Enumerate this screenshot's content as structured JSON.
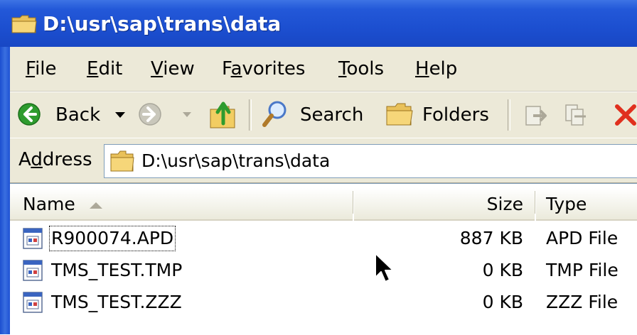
{
  "window": {
    "title": "D:\\usr\\sap\\trans\\data"
  },
  "menu": {
    "items": [
      {
        "accel": "F",
        "rest": "ile"
      },
      {
        "accel": "E",
        "rest": "dit"
      },
      {
        "accel": "V",
        "rest": "iew"
      },
      {
        "pre": "F",
        "accel": "a",
        "rest": "vorites"
      },
      {
        "accel": "T",
        "rest": "ools"
      },
      {
        "accel": "H",
        "rest": "elp"
      }
    ]
  },
  "toolbar": {
    "back_label": "Back",
    "search_label": "Search",
    "folders_label": "Folders"
  },
  "address": {
    "label_pre": "A",
    "label_accel": "d",
    "label_rest": "dress",
    "value": "D:\\usr\\sap\\trans\\data"
  },
  "list": {
    "columns": {
      "name": "Name",
      "size": "Size",
      "type": "Type"
    },
    "rows": [
      {
        "name": "R900074.APD",
        "size": "887 KB",
        "type": "APD File"
      },
      {
        "name": "TMS_TEST.TMP",
        "size": "0 KB",
        "type": "TMP File"
      },
      {
        "name": "TMS_TEST.ZZZ",
        "size": "0 KB",
        "type": "ZZZ File"
      }
    ]
  },
  "icons": {
    "title": "folder-icon",
    "back": "back-arrow-icon",
    "forward": "forward-arrow-icon",
    "up": "up-folder-icon",
    "search": "search-icon",
    "folders": "folders-icon",
    "move": "move-to-icon",
    "copy": "copy-to-icon",
    "delete": "delete-icon",
    "address": "folder-icon",
    "file": "generic-file-icon",
    "cursor": "mouse-pointer-icon"
  },
  "colors": {
    "titlebar": "#2358d8",
    "chrome": "#ece9d8",
    "back_green": "#2e9b2e",
    "delete_red": "#e0301e"
  }
}
